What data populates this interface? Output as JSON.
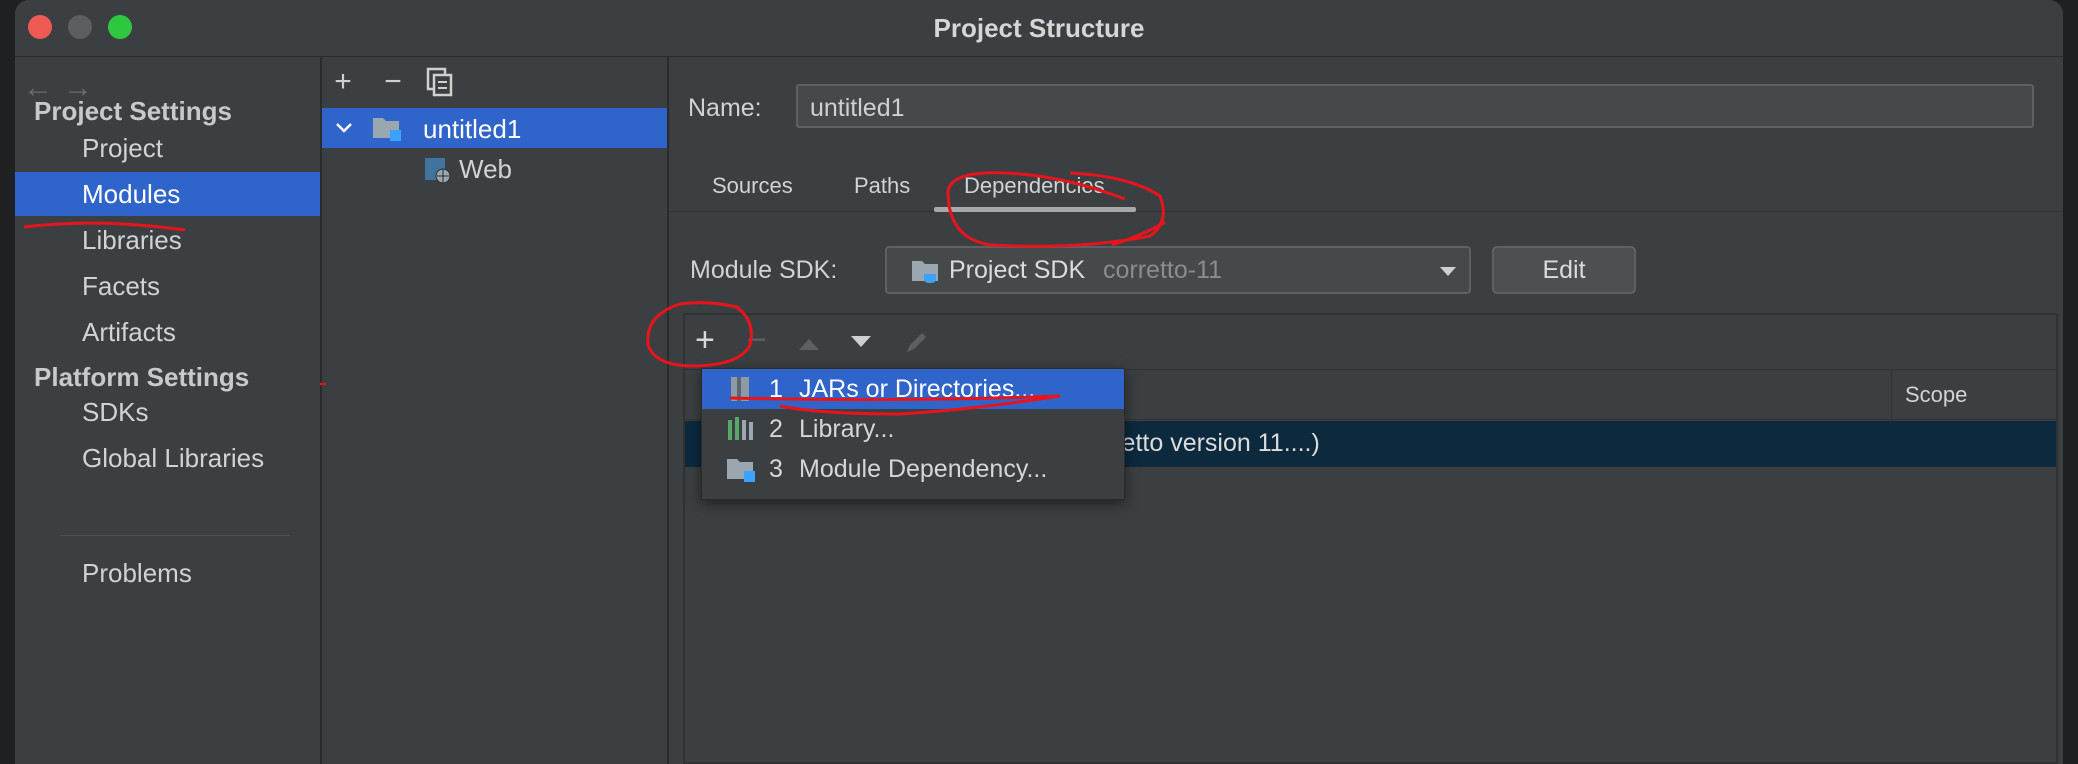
{
  "window": {
    "title": "Project Structure"
  },
  "left_pane": {
    "section1": "Project Settings",
    "items1": [
      "Project",
      "Modules",
      "Libraries",
      "Facets",
      "Artifacts"
    ],
    "section2": "Platform Settings",
    "items2": [
      "SDKs",
      "Global Libraries"
    ],
    "problems": "Problems",
    "selected": "Modules"
  },
  "module_tree": {
    "root": "untitled1",
    "child": "Web"
  },
  "module": {
    "name_label": "Name:",
    "name_value": "untitled1",
    "tabs": [
      "Sources",
      "Paths",
      "Dependencies"
    ],
    "active_tab": "Dependencies",
    "sdk_label": "Module SDK:",
    "sdk_value": "Project SDK",
    "sdk_hint": "corretto-11",
    "edit_label": "Edit",
    "column_scope": "Scope",
    "dep_row_text": "orretto version 11....)"
  },
  "add_menu": {
    "items": [
      {
        "num": "1",
        "label": "JARs or Directories..."
      },
      {
        "num": "2",
        "label": "Library..."
      },
      {
        "num": "3",
        "label": "Module Dependency..."
      }
    ]
  },
  "colors": {
    "selection": "#2f65ca",
    "annotation": "#e8141c",
    "window_bg": "#3c3f41"
  }
}
